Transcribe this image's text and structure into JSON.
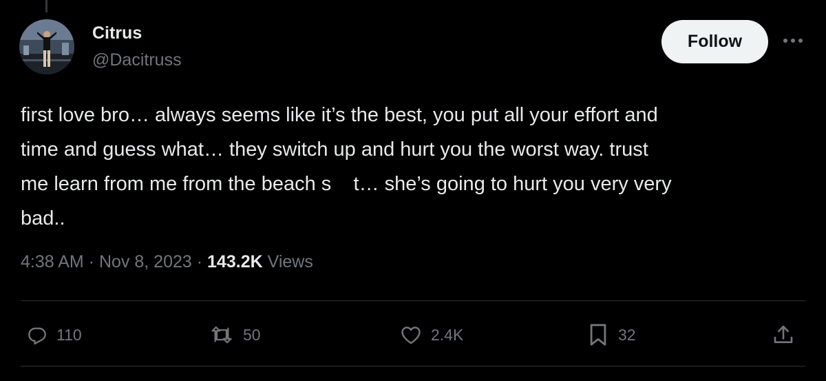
{
  "author": {
    "display_name": "Citrus",
    "handle": "@Dacitruss"
  },
  "follow_button": {
    "label": "Follow"
  },
  "more_icon": "more-horizontal-icon",
  "tweet": {
    "lines": [
      "first love bro… always seems like it’s the best, you put all your effort and",
      "time and guess what… they switch up and hurt you the worst way. trust",
      "me learn from me from the beach s    t… she’s going to hurt you very very",
      "bad.."
    ]
  },
  "meta": {
    "time": "4:38 AM",
    "date": "Nov 8, 2023",
    "separator": "·",
    "views_count": "143.2K",
    "views_label": "Views"
  },
  "actions": {
    "reply": {
      "icon": "reply-icon",
      "count": "110"
    },
    "retweet": {
      "icon": "retweet-icon",
      "count": "50"
    },
    "like": {
      "icon": "heart-icon",
      "count": "2.4K"
    },
    "bookmark": {
      "icon": "bookmark-icon",
      "count": "32"
    },
    "share": {
      "icon": "share-icon"
    }
  },
  "colors": {
    "background": "#000000",
    "primary_text": "#e7e9ea",
    "secondary_text": "#71767b",
    "divider": "#2f3336",
    "follow_bg": "#eff3f4"
  }
}
